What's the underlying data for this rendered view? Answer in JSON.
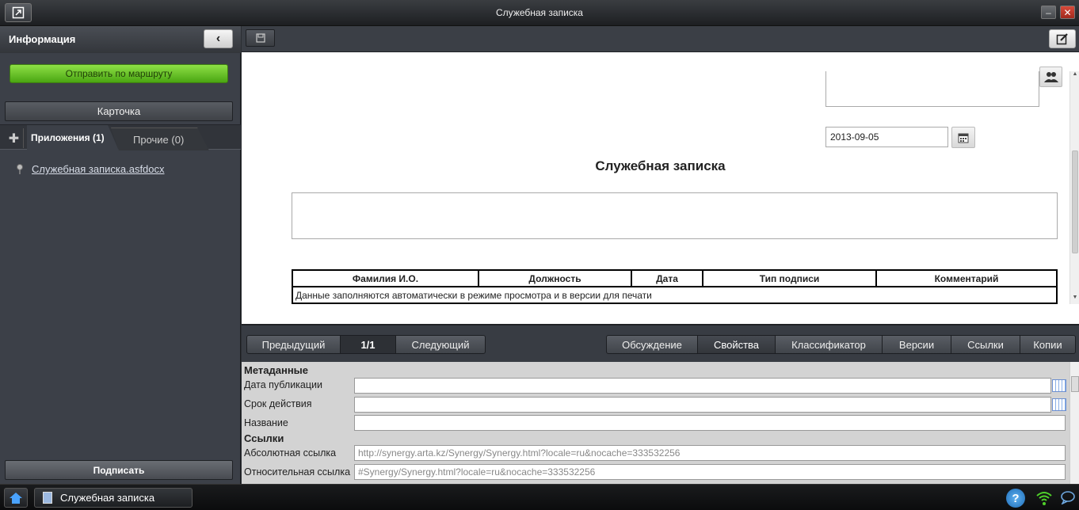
{
  "window": {
    "title": "Служебная записка",
    "app_icon": "open-external-icon",
    "minimize_icon": "minimize-icon",
    "close_icon": "close-icon"
  },
  "left_panel": {
    "header_title": "Информация",
    "collapse_icon": "chevron-left-icon",
    "route_button": "Отправить по маршруту",
    "card_button": "Карточка",
    "add_icon": "plus-icon",
    "tabs": [
      {
        "label": "Приложения (1)",
        "active": true
      },
      {
        "label": "Прочие (0)",
        "active": false
      }
    ],
    "files": [
      {
        "name": "Служебная записка.asfdocx",
        "icon": "pin-icon"
      }
    ],
    "sign_button": "Подписать"
  },
  "toolbar": {
    "save_icon": "save-icon",
    "edit_icon": "edit-icon"
  },
  "document": {
    "date_value": "2013-09-05",
    "title": "Служебная записка",
    "table": {
      "headers": [
        "Фамилия И.О.",
        "Должность",
        "Дата",
        "Тип подписи",
        "Комментарий"
      ],
      "note": "Данные заполняются автоматически в режиме просмотра и в версии для печати"
    }
  },
  "pager": {
    "prev": "Предыдущий",
    "page": "1/1",
    "next": "Следующий"
  },
  "bottom_tabs": [
    {
      "label": "Обсуждение",
      "active": false
    },
    {
      "label": "Свойства",
      "active": true
    },
    {
      "label": "Классификатор",
      "active": false
    },
    {
      "label": "Версии",
      "active": false
    },
    {
      "label": "Ссылки",
      "active": false
    },
    {
      "label": "Копии",
      "active": false
    }
  ],
  "properties": {
    "metadata_section": "Метаданные",
    "publish_date_label": "Дата публикации",
    "publish_date_value": "",
    "validity_label": "Срок действия",
    "validity_value": "",
    "name_label": "Название",
    "name_value": "",
    "links_section": "Ссылки",
    "absolute_link_label": "Абсолютная ссылка",
    "absolute_link_value": "http://synergy.arta.kz/Synergy/Synergy.html?locale=ru&nocache=333532256",
    "relative_link_label": "Относительная ссылка",
    "relative_link_value": "#Synergy/Synergy.html?locale=ru&nocache=333532256"
  },
  "taskbar": {
    "task_label": "Служебная записка",
    "help_label": "?"
  }
}
